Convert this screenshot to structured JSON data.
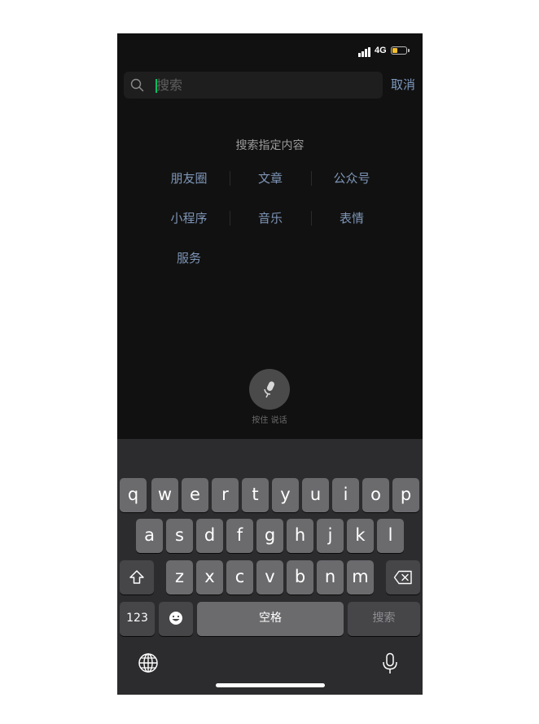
{
  "status": {
    "network": "4G",
    "battery_level": 0.35,
    "battery_color": "#f5c02c"
  },
  "search": {
    "placeholder": "搜索",
    "cancel_label": "取消",
    "caret_color": "#07c160"
  },
  "scope": {
    "heading": "搜索指定内容",
    "items": [
      "朋友圈",
      "文章",
      "公众号",
      "小程序",
      "音乐",
      "表情",
      "服务"
    ],
    "link_color": "#7e95b6"
  },
  "voice": {
    "label": "按住 说话",
    "icon": "microphone-icon"
  },
  "keyboard": {
    "row1": [
      "q",
      "w",
      "e",
      "r",
      "t",
      "y",
      "u",
      "i",
      "o",
      "p"
    ],
    "row2": [
      "a",
      "s",
      "d",
      "f",
      "g",
      "h",
      "j",
      "k",
      "l"
    ],
    "row3": [
      "z",
      "x",
      "c",
      "v",
      "b",
      "n",
      "m"
    ],
    "shift_icon": "shift-icon",
    "delete_icon": "backspace-icon",
    "numbers_label": "123",
    "emoji_icon": "emoji-icon",
    "space_label": "空格",
    "search_label": "搜索",
    "globe_icon": "globe-icon",
    "dictation_icon": "microphone-icon"
  }
}
